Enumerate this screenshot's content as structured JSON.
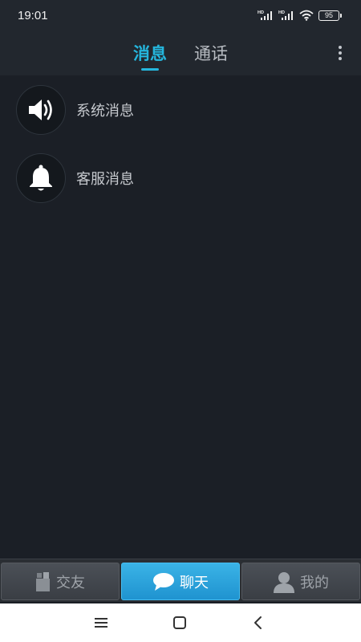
{
  "status_bar": {
    "time": "19:01",
    "signal_1_label": "HD",
    "signal_2_label": "HD",
    "battery_level": "95",
    "icons": [
      "hd-signal-icon",
      "hd-signal-icon",
      "wifi-icon",
      "battery-icon"
    ]
  },
  "header": {
    "tabs": [
      {
        "label": "消息",
        "active": true
      },
      {
        "label": "通话",
        "active": false
      }
    ],
    "more_icon": "more-vertical-icon"
  },
  "conversations": [
    {
      "label": "系统消息",
      "icon": "speaker-icon"
    },
    {
      "label": "客服消息",
      "icon": "bell-icon"
    }
  ],
  "bottom_nav": {
    "items": [
      {
        "label": "交友",
        "icon": "friends-icon",
        "active": false
      },
      {
        "label": "聊天",
        "icon": "chat-bubble-icon",
        "active": true
      },
      {
        "label": "我的",
        "icon": "user-icon",
        "active": false
      }
    ]
  },
  "system_nav": {
    "icons": [
      "menu-icon",
      "home-icon",
      "back-icon"
    ]
  },
  "colors": {
    "accent": "#25b6dd",
    "background": "#1b1f26",
    "header_bg": "#22272e",
    "nav_active": "#2a9fd9"
  }
}
